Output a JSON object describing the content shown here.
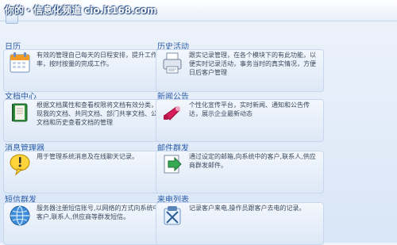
{
  "watermark": "你的・信息化频道 cio.it168.com",
  "items": [
    {
      "title": "日历",
      "desc": "有效的管理自己每天的日程安排，提升工作效率，按时按量的完成工作。",
      "icon": "calendar-icon"
    },
    {
      "title": "历史活动",
      "desc": "跟实记录管理，在各个模块下的有此功能，以便实时记录活动，事务当时的真实情况，方便日后客户管理",
      "icon": "history-printer-icon"
    },
    {
      "title": "文档中心",
      "desc": "根据文档属性和查看权限将文档有效分类，实现我的文档、共同文档、部门共享文档、公共文档和历史查看文档的管理",
      "icon": "book-icon"
    },
    {
      "title": "新闻公告",
      "desc": "个性化宣传平台，实时新闻、通知和公告传达，展示企业最新动态",
      "icon": "announcement-icon"
    },
    {
      "title": "消息管理器",
      "desc": "用于管理系统消息及在线聊天记录。",
      "icon": "message-bubble-icon"
    },
    {
      "title": "邮件群发",
      "desc": "通过设定的邮箱,向系统中的客户,联系人,供应商群发邮件。",
      "icon": "mail-send-icon"
    },
    {
      "title": "短信群发",
      "desc": "服务器注册短信账号,以网络的方式向系统中的客户,联系人,供应商等群发短信。",
      "icon": "globe-sms-icon"
    },
    {
      "title": "来电列表",
      "desc": "记录客户来电,操作员跟客户去电的记录。",
      "icon": "phone-list-icon"
    }
  ]
}
